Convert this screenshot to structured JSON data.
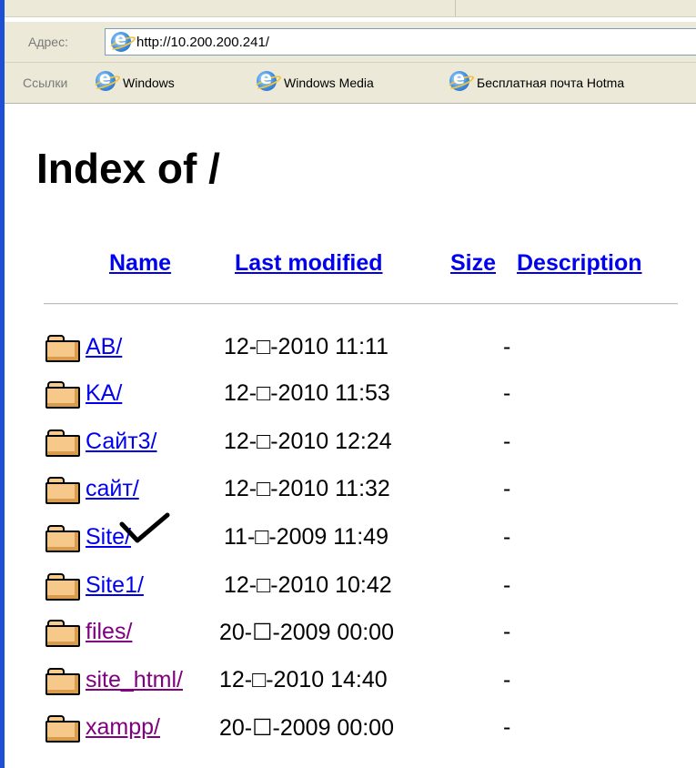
{
  "address_bar": {
    "label": "Адрес:",
    "url": "http://10.200.200.241/"
  },
  "links_bar": {
    "label": "Ссылки",
    "links": [
      "Windows",
      "Windows Media",
      "Бесплатная почта Hotma"
    ]
  },
  "page": {
    "title": "Index of /",
    "columns": {
      "name": "Name",
      "last_modified": "Last modified",
      "size": "Size",
      "description": "Description"
    },
    "rows": [
      {
        "name": "AB/",
        "date": "12-□-2010 11:11",
        "size": "-",
        "visited": false
      },
      {
        "name": "KA/",
        "date": "12-□-2010 11:53",
        "size": "-",
        "visited": false
      },
      {
        "name": "Сайт3/",
        "date": "12-□-2010 12:24",
        "size": "-",
        "visited": false
      },
      {
        "name": "сайт/",
        "date": "12-□-2010 11:32",
        "size": "-",
        "visited": false
      },
      {
        "name": "Site/",
        "date": "11-□-2009 11:49",
        "size": "-",
        "visited": false
      },
      {
        "name": "Site1/",
        "date": "12-□-2010 10:42",
        "size": "-",
        "visited": false
      },
      {
        "name": "files/",
        "date": "20-☐-2009 00:00",
        "size": "-",
        "visited": true
      },
      {
        "name": "site_html/",
        "date": "12-□-2010 14:40",
        "size": "-",
        "visited": true
      },
      {
        "name": "xampp/",
        "date": "20-☐-2009 00:00",
        "size": "-",
        "visited": true
      }
    ]
  },
  "colors": {
    "link": "#0000ee",
    "visited_link": "#800080",
    "toolbar_bg": "#ece9d8",
    "window_edge": "#1d4fd6"
  },
  "icons": [
    "ie-icon",
    "folder-icon",
    "checkmark-icon"
  ]
}
